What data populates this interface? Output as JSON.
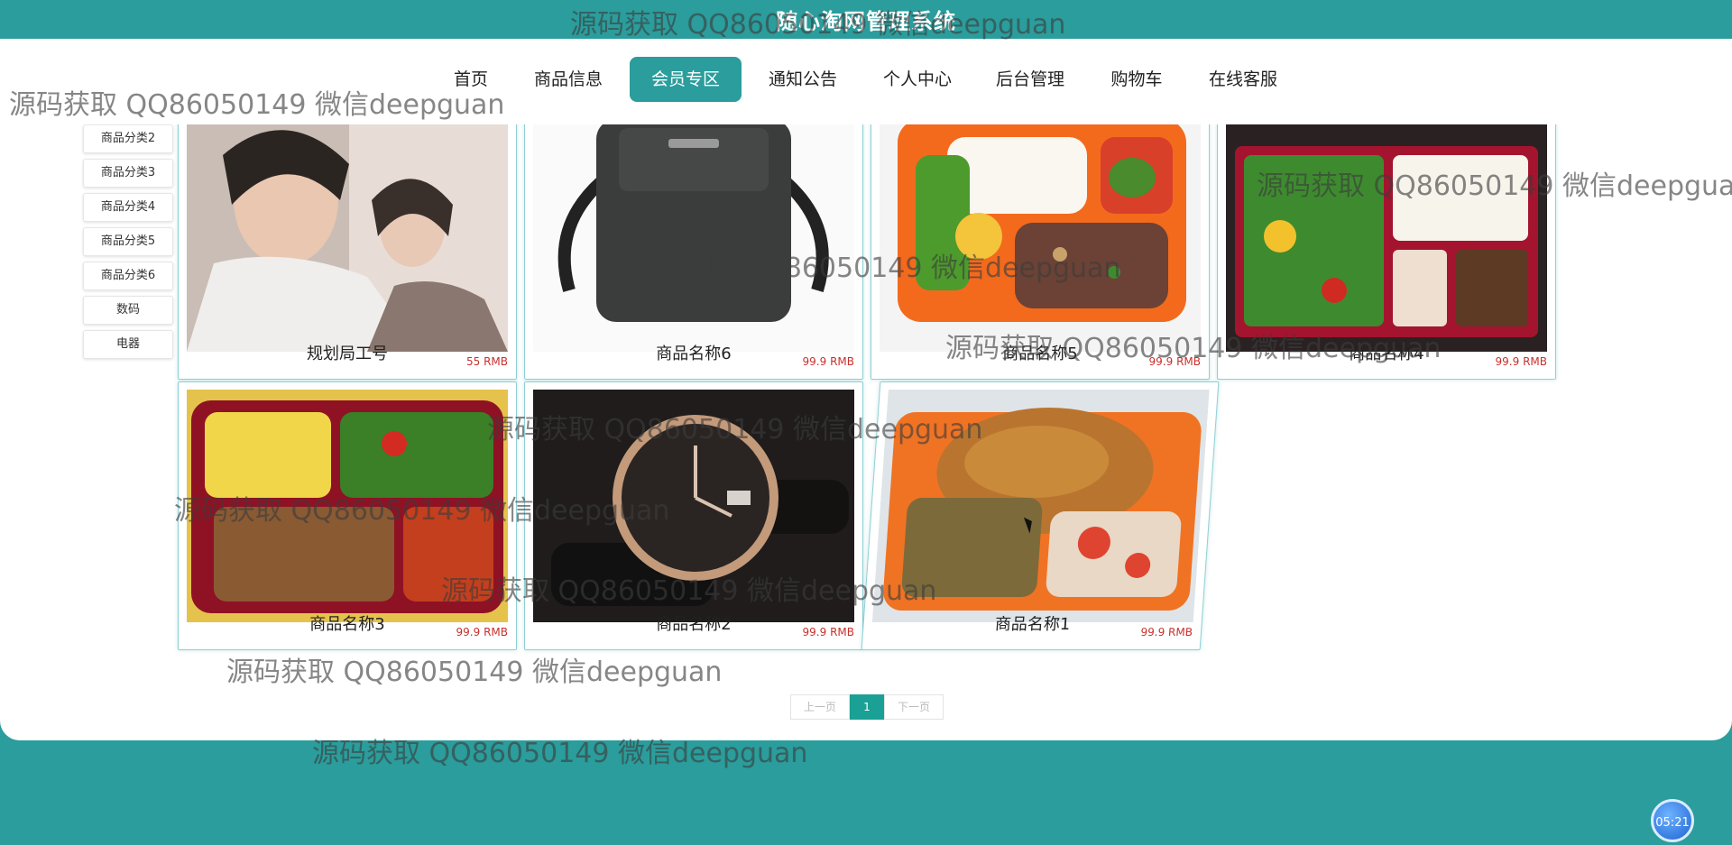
{
  "site": {
    "title": "随心淘网管理系统"
  },
  "nav": {
    "items": [
      {
        "label": "首页"
      },
      {
        "label": "商品信息"
      },
      {
        "label": "会员专区"
      },
      {
        "label": "通知公告"
      },
      {
        "label": "个人中心"
      },
      {
        "label": "后台管理"
      },
      {
        "label": "购物车"
      },
      {
        "label": "在线客服"
      }
    ],
    "active": "会员专区"
  },
  "categories": [
    "商品分类2",
    "商品分类3",
    "商品分类4",
    "商品分类5",
    "商品分类6",
    "数码",
    "电器"
  ],
  "products": [
    {
      "name": "规划局工号",
      "price": "55 RMB"
    },
    {
      "name": "商品名称6",
      "price": "99.9 RMB"
    },
    {
      "name": "商品名称5",
      "price": "99.9 RMB"
    },
    {
      "name": "商品名称4",
      "price": "99.9 RMB"
    },
    {
      "name": "商品名称3",
      "price": "99.9 RMB"
    },
    {
      "name": "商品名称2",
      "price": "99.9 RMB"
    },
    {
      "name": "商品名称1",
      "price": "99.9 RMB"
    }
  ],
  "pagination": {
    "prev": "上一页",
    "current": "1",
    "next": "下一页"
  },
  "watermark": "源码获取 QQ86050149 微信deepguan",
  "clock": "05:21",
  "colors": {
    "primary": "#2a9d9c",
    "price": "#c9302c",
    "pager_active": "#1aa094"
  }
}
